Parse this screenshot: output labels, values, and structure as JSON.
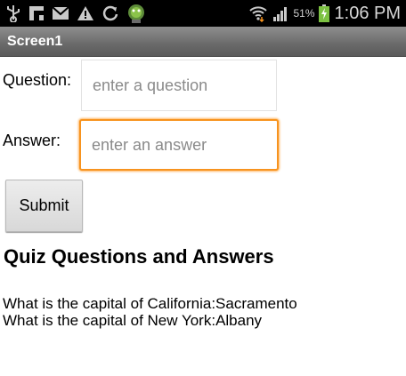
{
  "status_bar": {
    "icons": [
      "usb-icon",
      "flipboard-icon",
      "mail-icon",
      "warning-icon",
      "sync-icon",
      "android-icon",
      "wifi-icon",
      "signal-icon",
      "battery-charging-icon"
    ],
    "battery": "51%",
    "time": "1:06 PM"
  },
  "app": {
    "title": "Screen1"
  },
  "form": {
    "question_label": "Question:",
    "question_placeholder": "enter a question",
    "question_value": "",
    "answer_label": "Answer:",
    "answer_placeholder": "enter an answer",
    "answer_value": "",
    "submit_label": "Submit"
  },
  "quiz": {
    "heading": "Quiz Questions and Answers",
    "items": [
      "What is the capital of California:Sacramento",
      "What is the capital of New York:Albany"
    ]
  },
  "colors": {
    "status_bar": "#000000",
    "title_bar": "#6e6e6e",
    "focus_border": "#f7931e",
    "android_green": "#8bc34a",
    "battery_green": "#7cc142"
  }
}
